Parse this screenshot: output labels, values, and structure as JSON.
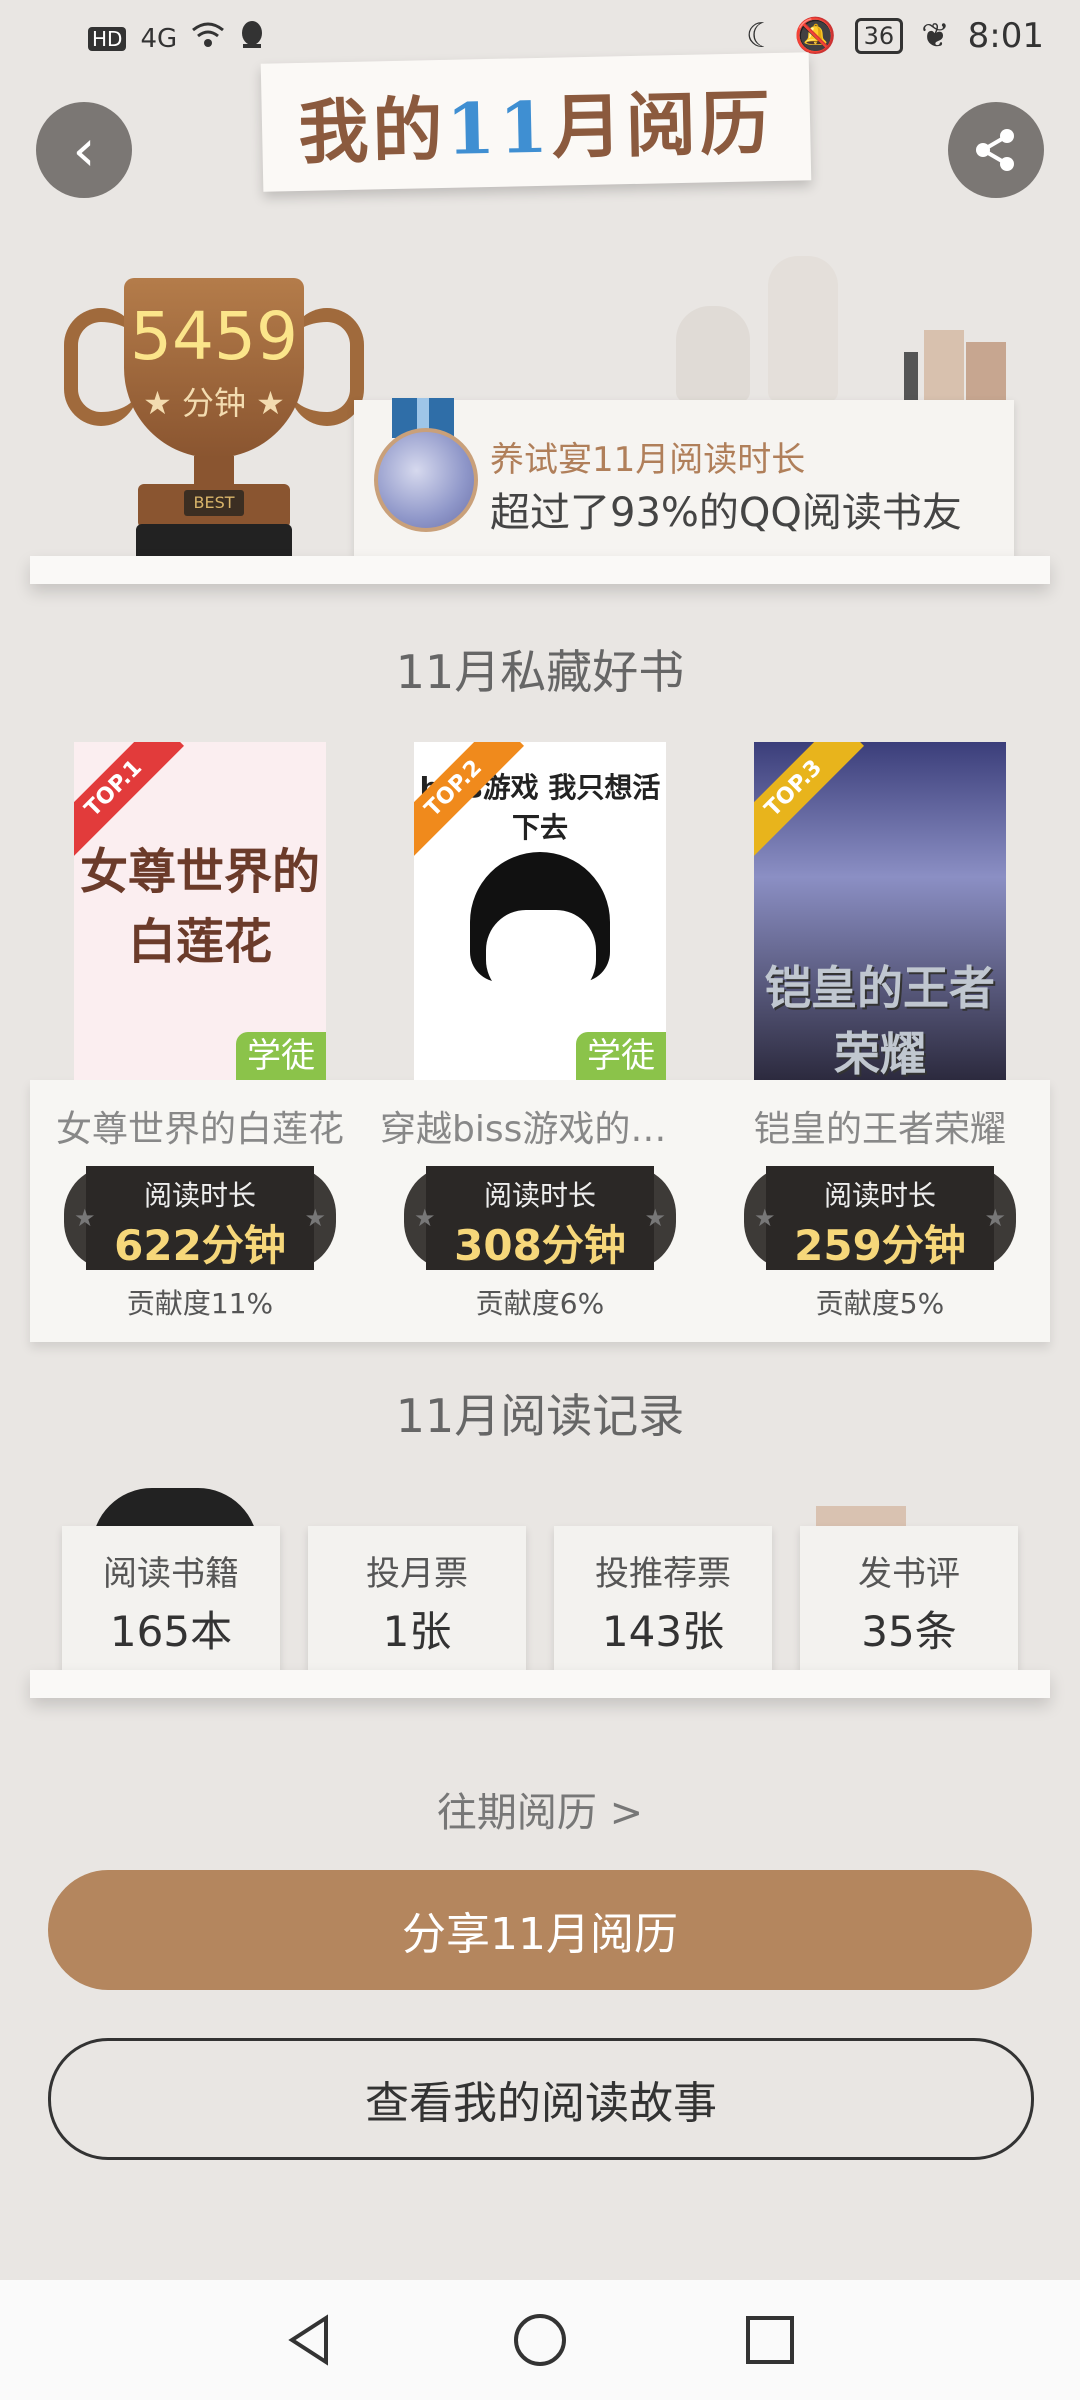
{
  "status_bar": {
    "left_icons": [
      "hd-icon",
      "4g-signal-icon",
      "wifi-icon",
      "qq-icon"
    ],
    "hd": "HD",
    "network": "4G",
    "battery": "36",
    "time": "8:01"
  },
  "header": {
    "title_pre": "我的",
    "title_num": "11",
    "title_post": "月阅历"
  },
  "trophy": {
    "minutes": "5459",
    "unit": "分钟",
    "badge": "BEST"
  },
  "achievement": {
    "line1": "养试宴11月阅读时长",
    "line2": "超过了93%的QQ阅读书友"
  },
  "favorites": {
    "title": "11月私藏好书",
    "read_label": "阅读时长",
    "books": [
      {
        "rank": "TOP.1",
        "name": "女尊世界的白莲花",
        "cover_title": "女尊世界的白莲花",
        "tag": "学徒",
        "time": "622分钟",
        "contribution": "贡献度11%",
        "ribbon_color": "#e23b3b"
      },
      {
        "rank": "TOP.2",
        "name": "穿越biss游戏的我...",
        "cover_title": "biss游戏 我只想活下去",
        "tag": "学徒",
        "time": "308分钟",
        "contribution": "贡献度6%",
        "ribbon_color": "#f08a1c"
      },
      {
        "rank": "TOP.3",
        "name": "铠皇的王者荣耀",
        "cover_title": "铠皇的王者荣耀",
        "tag": "",
        "time": "259分钟",
        "contribution": "贡献度5%",
        "ribbon_color": "#e8b41c"
      }
    ]
  },
  "records": {
    "title": "11月阅读记录",
    "stats": [
      {
        "label": "阅读书籍",
        "value": "165本"
      },
      {
        "label": "投月票",
        "value": "1张"
      },
      {
        "label": "投推荐票",
        "value": "143张"
      },
      {
        "label": "发书评",
        "value": "35条"
      }
    ]
  },
  "history_link": "往期阅历 >",
  "share_button": "分享11月阅历",
  "story_button": "查看我的阅读故事",
  "colors": {
    "accent": "#b4865e",
    "title_brown": "#8b5a3e",
    "title_blue": "#3f8fd2",
    "tag_green": "#8bc34a"
  }
}
